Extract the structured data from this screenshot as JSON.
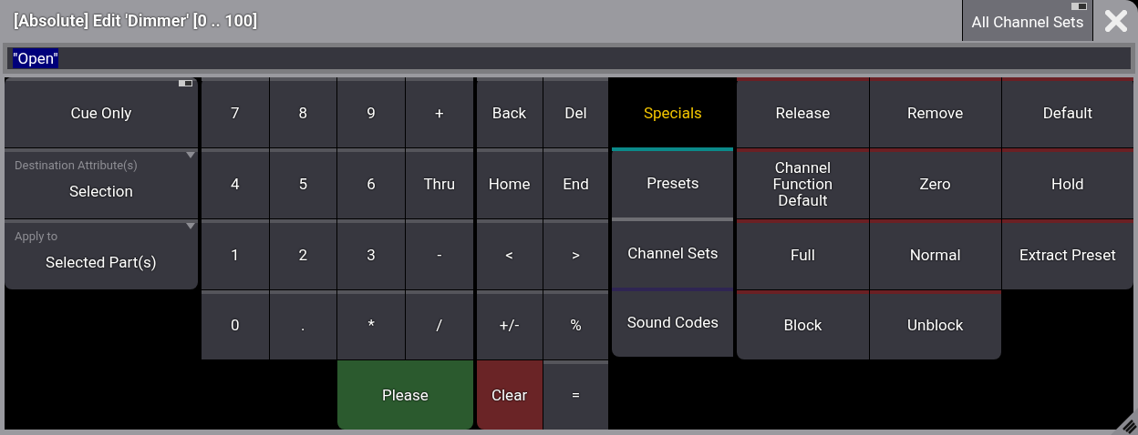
{
  "window": {
    "title": "[Absolute] Edit 'Dimmer' [0 .. 100]"
  },
  "title_button": {
    "label": "All Channel Sets",
    "on": true
  },
  "input": {
    "value": "\"Open\""
  },
  "options": [
    {
      "kind": "toggle",
      "label": "Cue Only",
      "on": true
    },
    {
      "kind": "dropdown",
      "caption": "Destination Attribute(s)",
      "label": "Selection"
    },
    {
      "kind": "dropdown",
      "caption": "Apply to",
      "label": "Selected Part(s)"
    }
  ],
  "numpad": [
    {
      "label": "7",
      "kind": "key"
    },
    {
      "label": "8",
      "kind": "key"
    },
    {
      "label": "9",
      "kind": "key"
    },
    {
      "label": "+",
      "kind": "key"
    },
    {
      "label": "4",
      "kind": "key"
    },
    {
      "label": "5",
      "kind": "key"
    },
    {
      "label": "6",
      "kind": "key"
    },
    {
      "label": "Thru",
      "kind": "key"
    },
    {
      "label": "1",
      "kind": "key"
    },
    {
      "label": "2",
      "kind": "key"
    },
    {
      "label": "3",
      "kind": "key"
    },
    {
      "label": "-",
      "kind": "key"
    },
    {
      "label": "0",
      "kind": "key"
    },
    {
      "label": ".",
      "kind": "key"
    },
    {
      "label": "*",
      "kind": "key"
    },
    {
      "label": "/",
      "kind": "key"
    },
    {
      "label": "Please",
      "kind": "please"
    }
  ],
  "edit_keys": [
    {
      "label": "Back",
      "kind": "key"
    },
    {
      "label": "Del",
      "kind": "key"
    },
    {
      "label": "Home",
      "kind": "key"
    },
    {
      "label": "End",
      "kind": "key"
    },
    {
      "label": "<",
      "kind": "key"
    },
    {
      "label": ">",
      "kind": "key"
    },
    {
      "label": "+/-",
      "kind": "key"
    },
    {
      "label": "%",
      "kind": "key"
    },
    {
      "label": "Clear",
      "kind": "clear"
    },
    {
      "label": "=",
      "kind": "key"
    }
  ],
  "tabs": [
    {
      "label": "Specials",
      "selected": true
    },
    {
      "label": "Presets",
      "selected": false,
      "color": "#0b8a8a"
    },
    {
      "label": "Channel Sets",
      "selected": false,
      "color": "#6e6e73"
    },
    {
      "label": "Sound Codes",
      "selected": false,
      "color": "#2f2553"
    }
  ],
  "specials": [
    "Release",
    "Remove",
    "Default",
    "Channel Function Default",
    "Zero",
    "Hold",
    "Full",
    "Normal",
    "Extract Preset",
    "Block",
    "Unblock"
  ]
}
